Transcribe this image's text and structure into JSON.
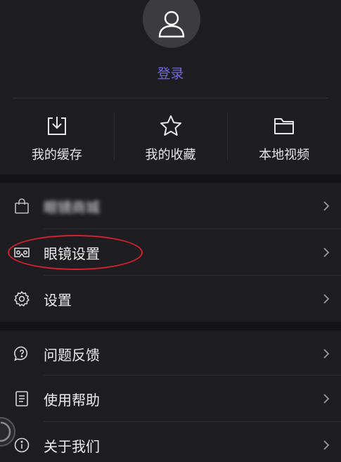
{
  "header": {
    "login_label": "登录"
  },
  "quick_actions": [
    {
      "label": "我的缓存",
      "icon": "download-box-icon"
    },
    {
      "label": "我的收藏",
      "icon": "star-icon"
    },
    {
      "label": "本地视频",
      "icon": "folder-icon"
    }
  ],
  "menu": {
    "group1": [
      {
        "label": "眼镜商城",
        "icon": "shopping-bag-icon",
        "blurred": true
      },
      {
        "label": "眼镜设置",
        "icon": "vr-glasses-icon",
        "highlighted": true
      },
      {
        "label": "设置",
        "icon": "gear-icon"
      }
    ],
    "group2": [
      {
        "label": "问题反馈",
        "icon": "feedback-bubble-icon"
      },
      {
        "label": "使用帮助",
        "icon": "help-list-icon"
      },
      {
        "label": "关于我们",
        "icon": "info-icon"
      }
    ]
  },
  "colors": {
    "background": "#1e1e22",
    "section_band": "#141417",
    "accent": "#7466e0",
    "highlight_ellipse": "#d4202f"
  }
}
